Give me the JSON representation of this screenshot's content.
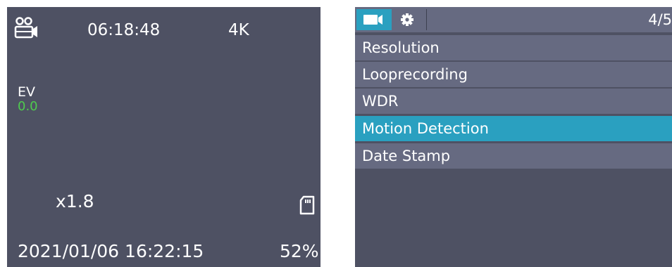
{
  "viewfinder": {
    "record_time": "06:18:48",
    "resolution": "4K",
    "ev_label": "EV",
    "ev_value": "0.0",
    "zoom": "x1.8",
    "datetime": "2021/01/06 16:22:15",
    "battery": "52%",
    "icons": [
      "video-camera-icon",
      "sd-card-icon"
    ],
    "colors": {
      "background": "#4e5163",
      "ev_value": "#4ecb4e"
    }
  },
  "menu": {
    "tabs": [
      "video-tab-icon",
      "settings-gear-icon"
    ],
    "page_indicator": "4/5",
    "items": [
      {
        "label": "Resolution"
      },
      {
        "label": "Looprecording"
      },
      {
        "label": "WDR"
      },
      {
        "label": "Motion Detection",
        "selected": true
      },
      {
        "label": "Date Stamp"
      }
    ],
    "colors": {
      "item": "#666a81",
      "selected": "#2aa0c0"
    }
  }
}
